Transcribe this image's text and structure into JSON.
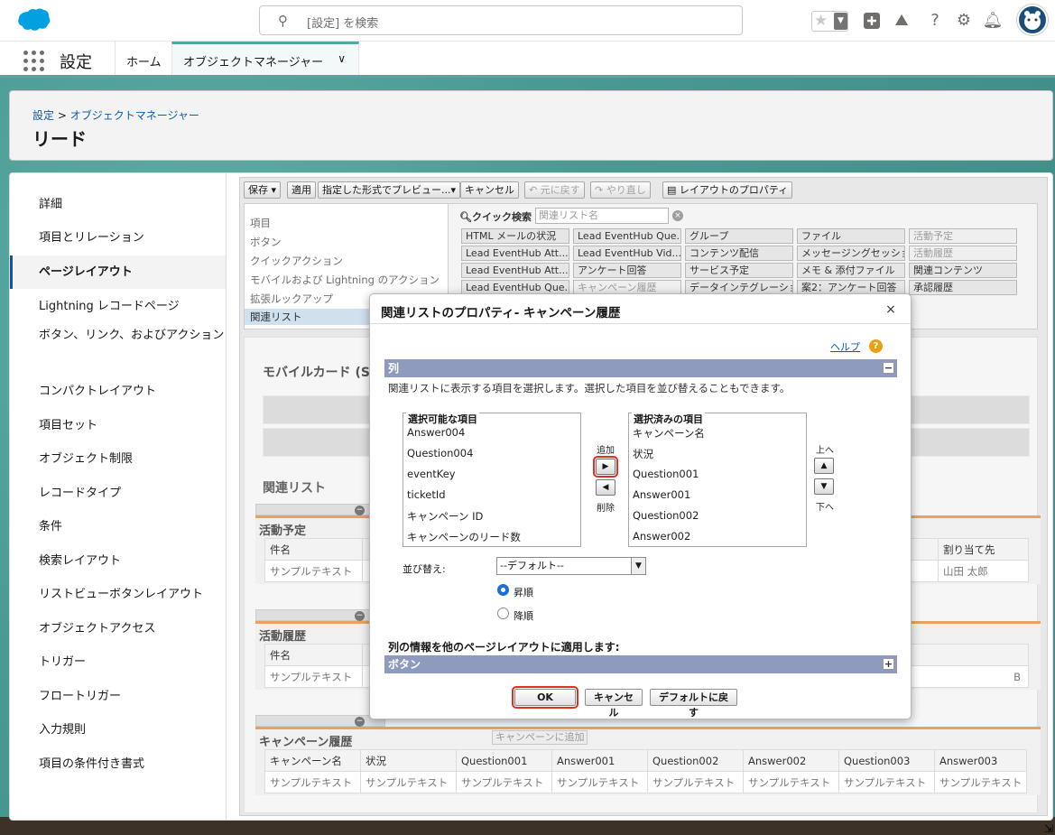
{
  "header": {
    "search_placeholder": "[設定] を検索"
  },
  "nav": {
    "app_name": "設定",
    "tabs": [
      "ホーム",
      "オブジェクトマネージャー"
    ]
  },
  "page": {
    "breadcrumb_root": "設定",
    "breadcrumb_sep": ">",
    "breadcrumb_current": "オブジェクトマネージャー",
    "title": "リード"
  },
  "sidebar": {
    "items": [
      "詳細",
      "項目とリレーション",
      "ページレイアウト",
      "Lightning レコードページ",
      "ボタン、リンク、およびアクション",
      "コンパクトレイアウト",
      "項目セット",
      "オブジェクト制限",
      "レコードタイプ",
      "条件",
      "検索レイアウト",
      "リストビューボタンレイアウト",
      "オブジェクトアクセス",
      "トリガー",
      "フロートリガー",
      "入力規則",
      "項目の条件付き書式"
    ]
  },
  "toolbar": {
    "save": "保存",
    "apply": "適用",
    "preview": "指定した形式でプレビュー...",
    "cancel": "キャンセル",
    "undo": "元に戻す",
    "redo": "やり直し",
    "layout_props": "レイアウトのプロパティ"
  },
  "palette": {
    "categories": [
      "項目",
      "ボタン",
      "クイックアクション",
      "モバイルおよび Lightning のアクション",
      "拡張ルックアップ",
      "関連リスト"
    ],
    "quick_search_label": "クイック検索",
    "quick_search_placeholder": "関連リスト名",
    "items": [
      [
        "HTML メールの状況",
        "Lead EventHub Que...",
        "グループ",
        "ファイル",
        "活動予定"
      ],
      [
        "Lead EventHub Att...",
        "Lead EventHub Vid...",
        "コンテンツ配信",
        "メッセージングセッション",
        "活動履歴"
      ],
      [
        "Lead EventHub Att...",
        "アンケート回答",
        "サービス予定",
        "メモ & 添付ファイル",
        "関連コンテンツ"
      ],
      [
        "Lead EventHub Que...",
        "キャンペーン履歴",
        "データインテグレーション",
        "案2：アンケート回答",
        "承認履歴"
      ]
    ]
  },
  "canvas": {
    "mobile_title": "モバイルカード (Sal",
    "related_title": "関連リスト",
    "sample": "サンプルテキスト",
    "lists": [
      {
        "title": "活動予定",
        "col": "件名",
        "extra_col": "割り当て先",
        "extra_val": "山田 太郎"
      },
      {
        "title": "活動履歴",
        "col": "件名",
        "extra_col": "",
        "extra_val": "B"
      },
      {
        "title": "キャンペーン履歴",
        "add_button": "キャンペーンに追加",
        "cols": [
          "キャンペーン名",
          "状況",
          "Question001",
          "Answer001",
          "Question002",
          "Answer002",
          "Question003",
          "Answer003"
        ]
      }
    ]
  },
  "modal": {
    "title": "関連リストのプロパティ- キャンペーン履歴",
    "close": "×",
    "help": "ヘルプ",
    "section_columns": "列",
    "desc": "関連リストに表示する項目を選択します。選択した項目を並び替えることもできます。",
    "available_label": "選択可能な項目",
    "available": [
      "Answer004",
      "Question004",
      "eventKey",
      "ticketId",
      "キャンペーン ID",
      "キャンペーンのリード数"
    ],
    "selected_label": "選択済みの項目",
    "selected": [
      "キャンペーン名",
      "状況",
      "Question001",
      "Answer001",
      "Question002",
      "Answer002"
    ],
    "add": "追加",
    "remove": "削除",
    "up": "上へ",
    "down": "下へ",
    "sort_label": "並び替え:",
    "sort_value": "--デフォルト--",
    "asc": "昇順",
    "desc_order": "降順",
    "apply_label": "列の情報を他のページレイアウトに適用します:",
    "section_buttons": "ボタン",
    "ok": "OK",
    "cancel": "キャンセル",
    "reset": "デフォルトに戻す",
    "collapse": "−",
    "expand": "+"
  },
  "colors": {
    "brand": "#00a1e0",
    "teal": "#4fa29c",
    "section": "#8e9bbf",
    "highlight": "#e0301e"
  }
}
